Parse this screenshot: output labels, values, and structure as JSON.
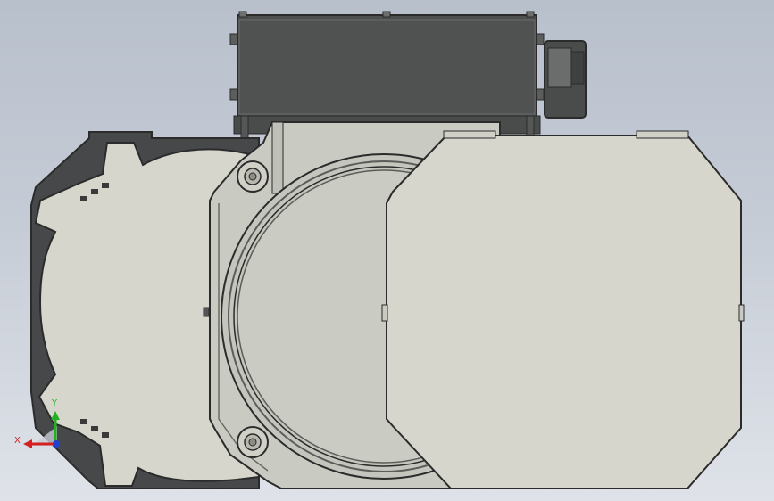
{
  "viewport": {
    "background_top": "#b8c0cc",
    "background_bottom": "#dfe3e9"
  },
  "colors": {
    "body_dark": "#46484a",
    "body_mid": "#5a5c5e",
    "face_light": "#d6d6cc",
    "face_mid": "#c9cac2",
    "outline": "#2b2b2b",
    "terminal_box": "#4d4f4e",
    "x_axis": "#d42020",
    "y_axis": "#22b022",
    "z_axis": "#2040d0"
  },
  "triad": {
    "x_label": "X",
    "y_label": "Y",
    "icon": "coordinate-triad-icon"
  }
}
